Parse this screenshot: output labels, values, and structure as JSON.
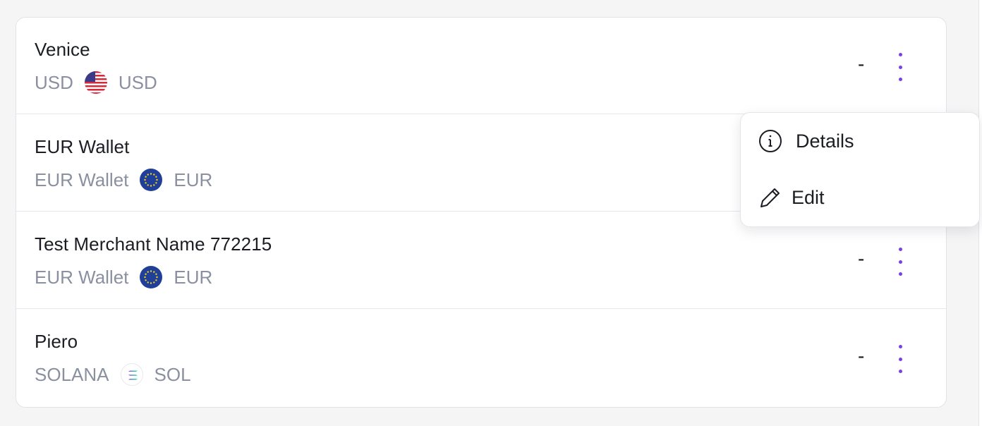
{
  "rows": [
    {
      "title": "Venice",
      "account": "USD",
      "flag_icon": "us-flag-icon",
      "currency": "USD",
      "amount": "-"
    },
    {
      "title": "EUR Wallet",
      "account": "EUR Wallet",
      "flag_icon": "eu-flag-icon",
      "currency": "EUR",
      "amount": "-"
    },
    {
      "title": "Test Merchant Name 772215",
      "account": "EUR Wallet",
      "flag_icon": "eu-flag-icon",
      "currency": "EUR",
      "amount": "-"
    },
    {
      "title": "Piero",
      "account": "SOLANA",
      "flag_icon": "solana-icon",
      "currency": "SOL",
      "amount": "-"
    }
  ],
  "menu": {
    "items": [
      {
        "label": "Details",
        "icon": "info-icon"
      },
      {
        "label": "Edit",
        "icon": "pencil-icon"
      }
    ]
  },
  "colors": {
    "accent": "#7b3fe4",
    "text_primary": "#1b1d23",
    "text_secondary": "#8a90a0"
  }
}
